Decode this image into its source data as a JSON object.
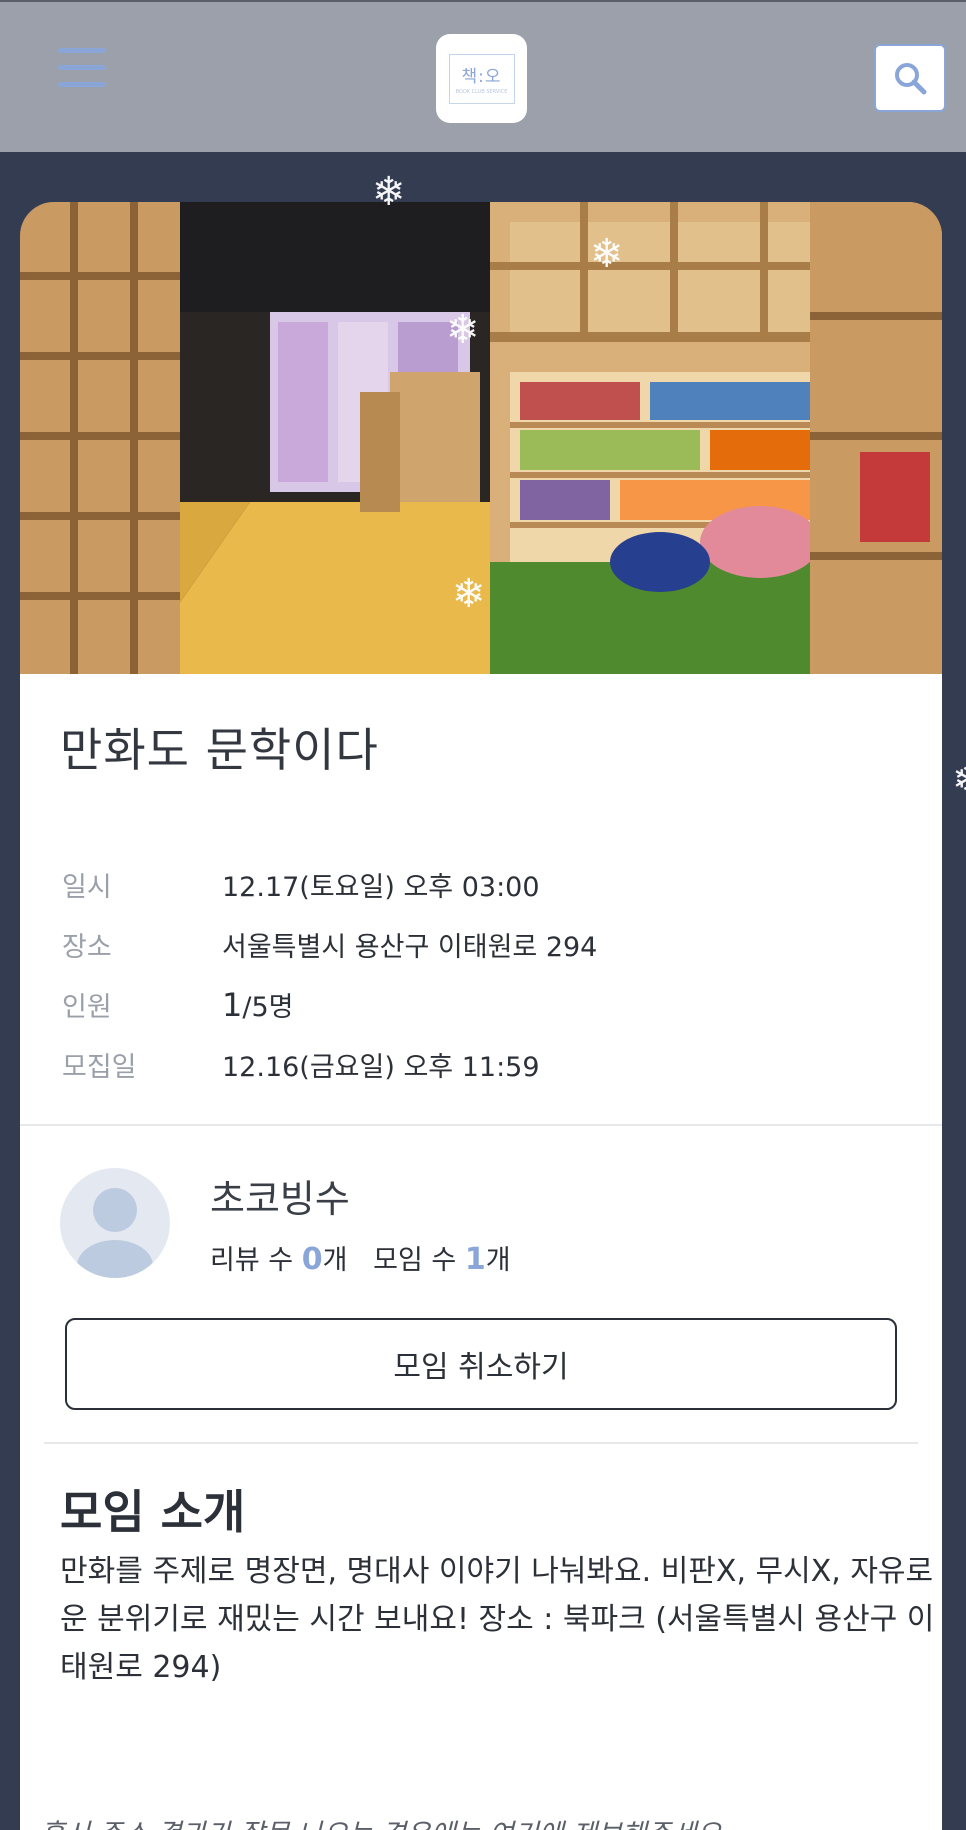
{
  "header": {
    "logo_text": "책:오",
    "logo_subtext": "BOOK CLUB SERVICE",
    "menu_icon": "hamburger-menu-icon",
    "search_icon": "search-icon"
  },
  "meeting": {
    "title": "만화도 문학이다",
    "details": [
      {
        "label": "일시",
        "value": "12.17(토요일) 오후 03:00"
      },
      {
        "label": "장소",
        "value": "서울특별시 용산구 이태원로 294"
      },
      {
        "label": "인원",
        "current": "1",
        "total": "/5명"
      },
      {
        "label": "모집일",
        "value": "12.16(금요일) 오후 11:59"
      }
    ]
  },
  "host": {
    "name": "초코빙수",
    "review_label": "리뷰 수 ",
    "review_count": "0",
    "review_unit": "개",
    "meeting_label": "모임 수 ",
    "meeting_count": "1",
    "meeting_unit": "개"
  },
  "actions": {
    "cancel_label": "모임 취소하기"
  },
  "intro": {
    "title": "모임 소개",
    "text": "만화를 주제로 명장면, 명대사 이야기 나눠봐요. 비판X, 무시X, 자유로운 분위기로 재밌는 시간 보내요! 장소 : 북파크 (서울특별시 용산구 이태원로 294)"
  },
  "footer_note": "혹시 주소 결과가 잘못 나오는 경우에는 여기에 제보해주세요.",
  "decor": {
    "snowflake": "❄"
  },
  "colors": {
    "accent": "#8aa5d8",
    "header_bg": "#9ba0aa",
    "page_bg": "#343c52",
    "text": "#2c3038",
    "label": "#9aa0aa"
  }
}
